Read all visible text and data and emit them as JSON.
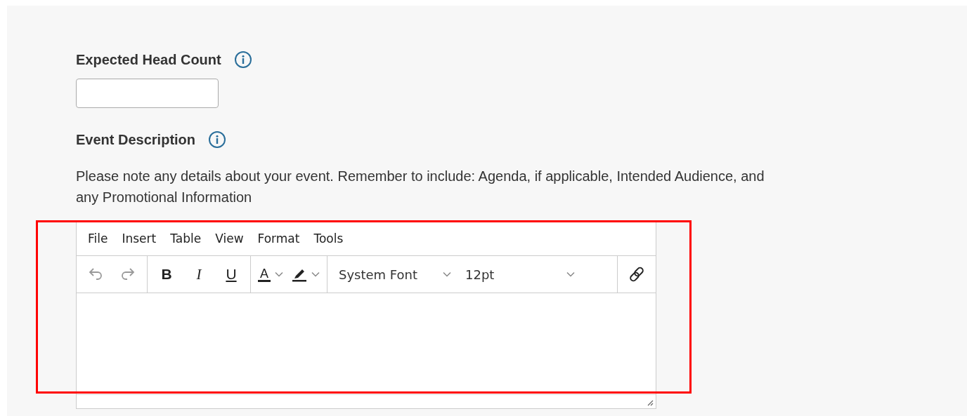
{
  "fields": [
    {
      "kind": "input",
      "label": "Expected Head Count"
    },
    {
      "kind": "editor",
      "label": "Event Description",
      "help": "Please note any details about your event. Remember to include: Agenda, if applicable, Intended Audience, and any Promotional Information"
    }
  ],
  "editor": {
    "menu": [
      "File",
      "Insert",
      "Table",
      "View",
      "Format",
      "Tools"
    ],
    "toolbar": [
      [
        {
          "kind": "undo",
          "disabled": true
        },
        {
          "kind": "redo",
          "disabled": true
        }
      ],
      [
        {
          "kind": "bold",
          "label": "B",
          "disabled": false
        },
        {
          "kind": "italic",
          "label": "I",
          "disabled": false
        },
        {
          "kind": "underline",
          "label": "U",
          "disabled": false
        }
      ],
      [
        {
          "kind": "text-color",
          "label": "A",
          "disabled": false
        },
        {
          "kind": "highlight",
          "disabled": false
        }
      ],
      [
        {
          "kind": "select",
          "value": "System Font",
          "disabled": false
        },
        {
          "kind": "select",
          "value": "12pt",
          "disabled": false
        }
      ],
      [
        {
          "kind": "link",
          "disabled": false
        }
      ]
    ]
  }
}
